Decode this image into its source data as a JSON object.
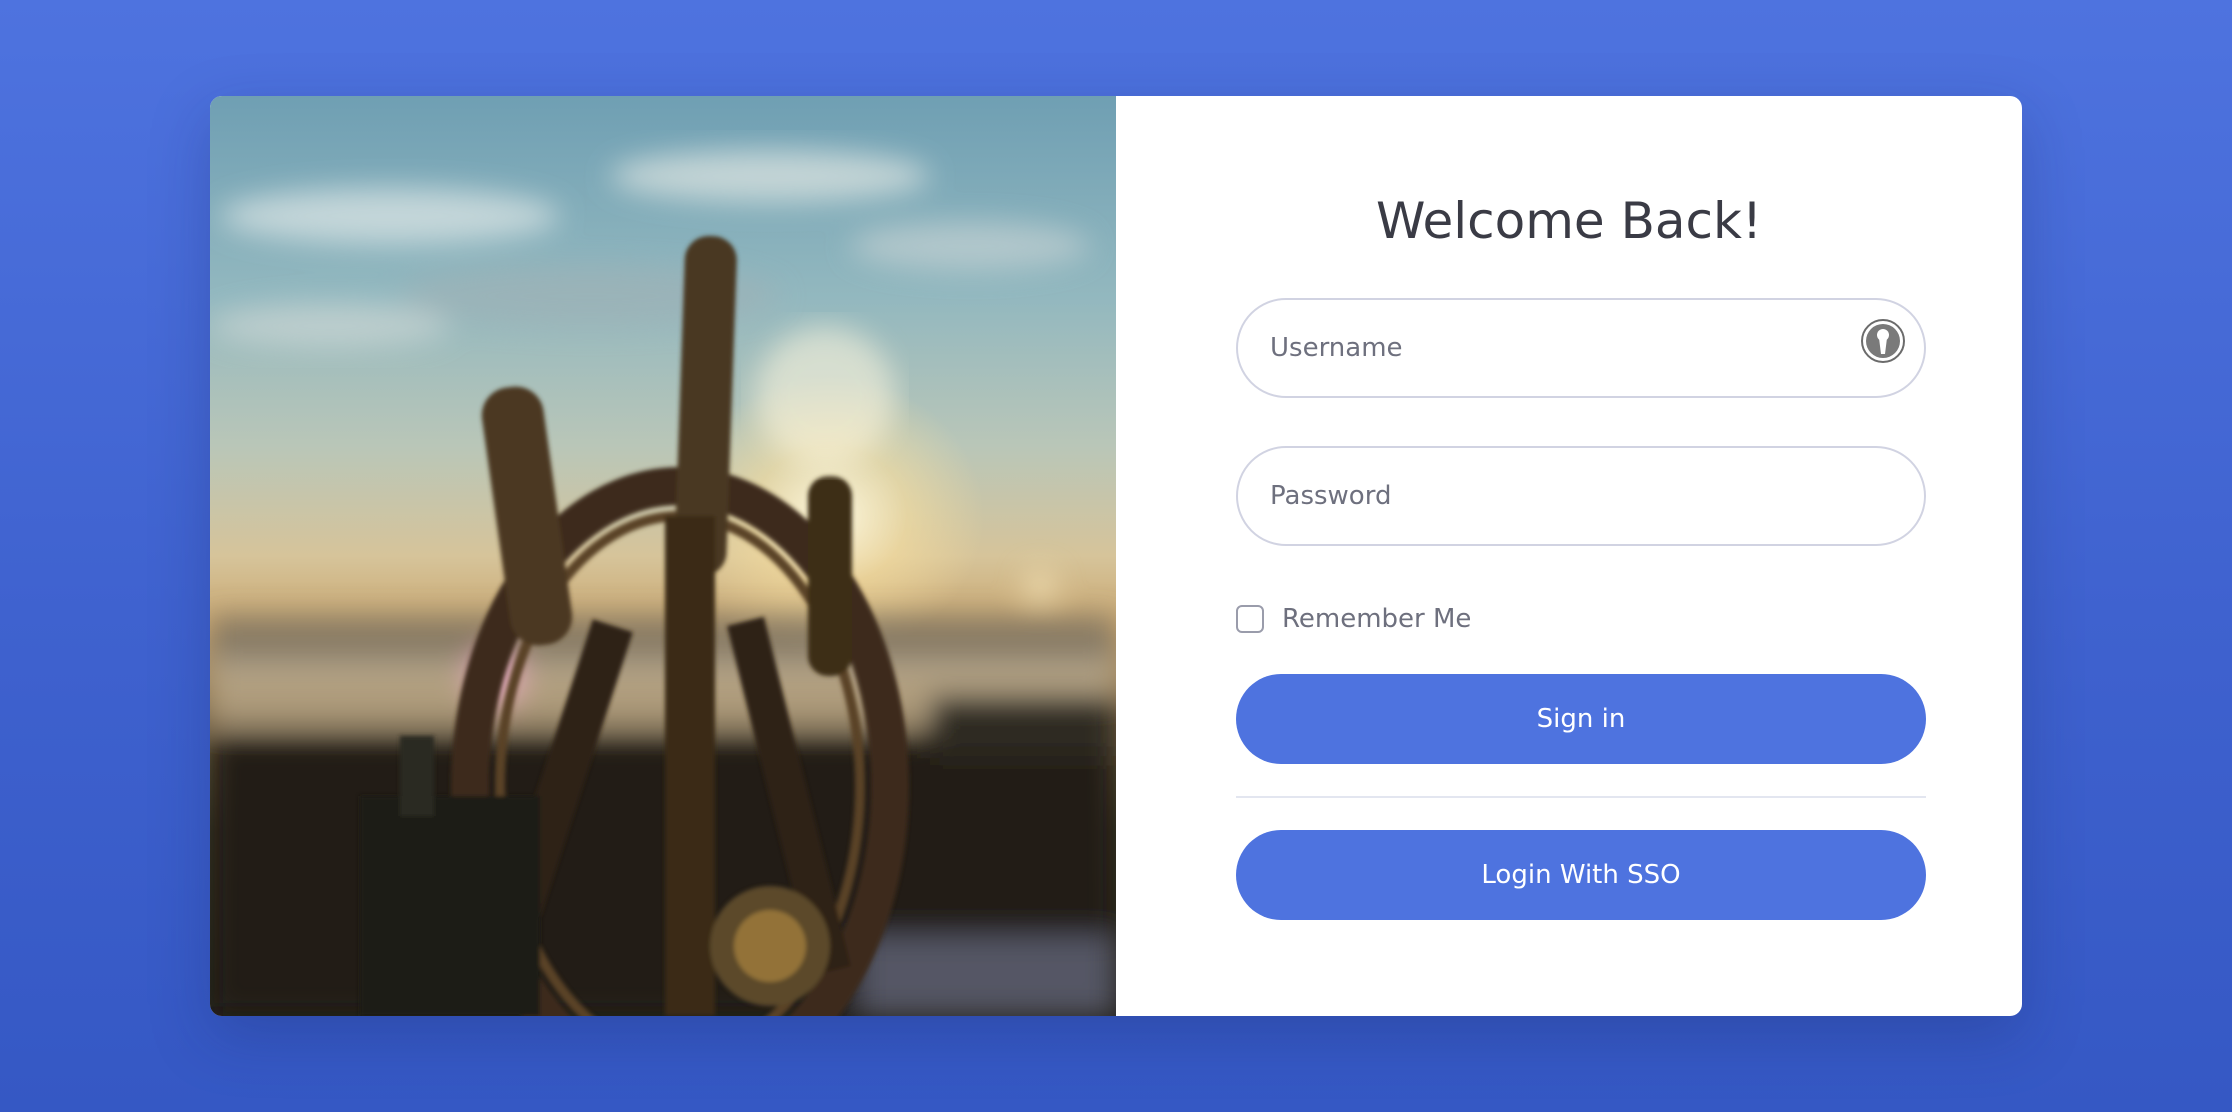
{
  "login": {
    "title": "Welcome Back!",
    "username_placeholder": "Username",
    "password_placeholder": "Password",
    "remember_label": "Remember Me",
    "sign_in_label": "Sign in",
    "sso_label": "Login With SSO"
  },
  "colors": {
    "background": "#4e73df",
    "primary_button": "#4e73df",
    "card": "#ffffff",
    "title_text": "#3a3b45",
    "muted_text": "#6e707e",
    "input_border": "#d1d3e2"
  },
  "icons": {
    "password_manager": "keeper-keyhole-icon"
  }
}
